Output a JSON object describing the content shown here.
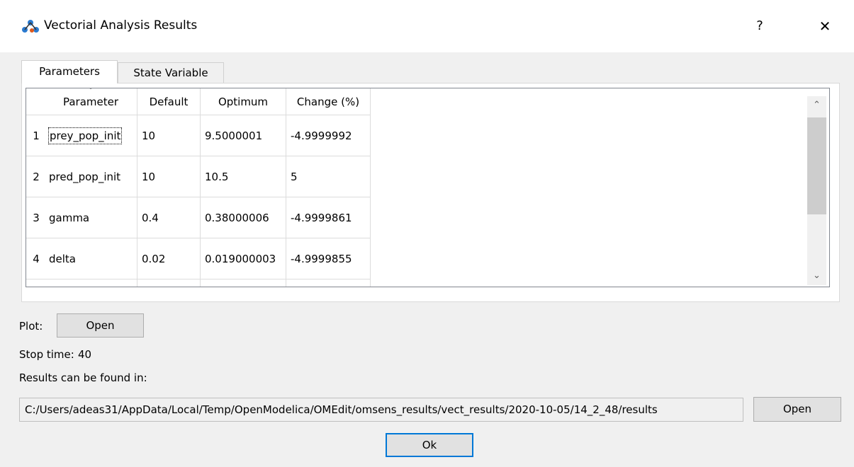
{
  "window": {
    "title": "Vectorial Analysis Results",
    "help_label": "?",
    "close_label": "✕",
    "icon": "network-graph-icon"
  },
  "tabs": [
    {
      "label": "Parameters",
      "active": true
    },
    {
      "label": "State Variable",
      "active": false
    }
  ],
  "table": {
    "columns": [
      "Parameter",
      "Default",
      "Optimum",
      "Change (%)"
    ],
    "rows": [
      {
        "index": "1",
        "parameter": "prey_pop_init",
        "default": "10",
        "optimum": "9.5000001",
        "change": "-4.9999992"
      },
      {
        "index": "2",
        "parameter": "pred_pop_init",
        "default": "10",
        "optimum": "10.5",
        "change": "5"
      },
      {
        "index": "3",
        "parameter": "gamma",
        "default": "0.4",
        "optimum": "0.38000006",
        "change": "-4.9999861"
      },
      {
        "index": "4",
        "parameter": "delta",
        "default": "0.02",
        "optimum": "0.019000003",
        "change": "-4.9999855"
      }
    ],
    "scroll_up": "⌃",
    "scroll_down": "⌄"
  },
  "plot": {
    "label": "Plot:",
    "open_label": "Open"
  },
  "stop_time": {
    "label": "Stop time:",
    "value": "40"
  },
  "results": {
    "label": "Results can be found in:",
    "path": "C:/Users/adeas31/AppData/Local/Temp/OpenModelica/OMEdit/omsens_results/vect_results/2020-10-05/14_2_48/results",
    "open_label": "Open"
  },
  "ok_label": "Ok"
}
